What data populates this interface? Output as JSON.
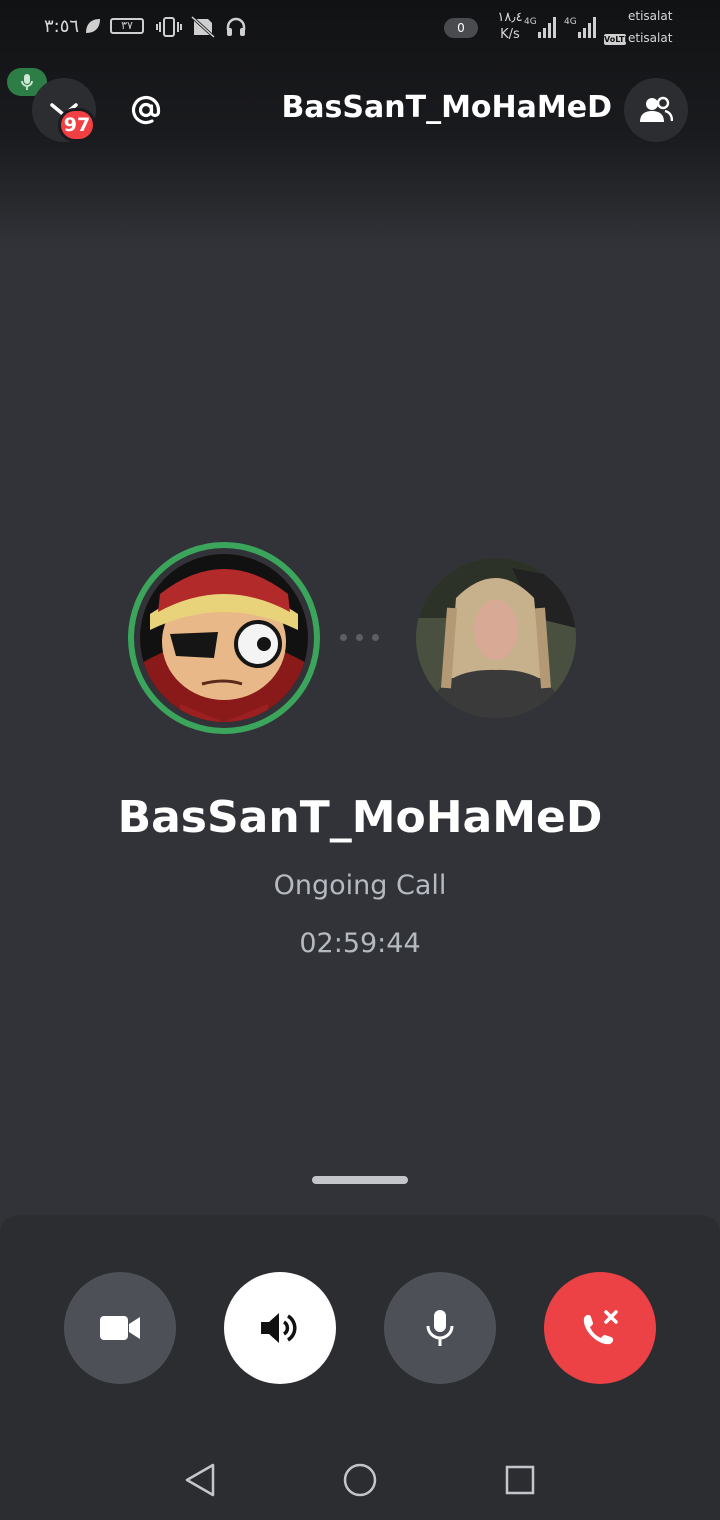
{
  "status_bar": {
    "time": "٣:٥٦",
    "battery": "٣٧",
    "data_pill": "0",
    "speed_value": "١٨٫٤",
    "speed_unit": "K/s",
    "network1": "4G",
    "network2": "4G",
    "volte": "VoLTE",
    "carrier1": "etisalat",
    "carrier2": "etisalat"
  },
  "header": {
    "badge_count": "97",
    "title": "BasSanT_MoHaMeD"
  },
  "call": {
    "name": "BasSanT_MoHaMeD",
    "status": "Ongoing Call",
    "timer": "02:59:44"
  },
  "controls": {
    "icons": [
      "video-camera-icon",
      "speaker-icon",
      "microphone-icon",
      "hang-up-icon"
    ],
    "colors": {
      "default": "#4e5058",
      "active": "#ffffff",
      "danger": "#ed4245",
      "speaking_ring": "#3ba55c"
    }
  },
  "nav": {
    "icons": [
      "back-icon",
      "home-icon",
      "recents-icon"
    ]
  }
}
